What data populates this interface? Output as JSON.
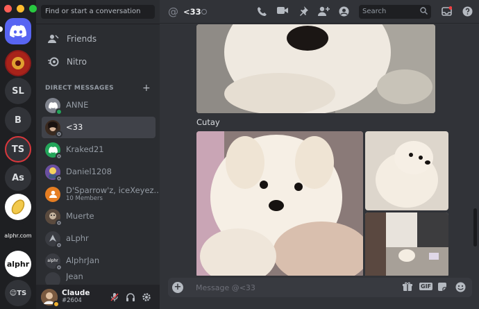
{
  "window": {
    "controls": [
      "close",
      "minimize",
      "maximize"
    ]
  },
  "rail": {
    "servers": [
      {
        "label": "",
        "icon": "discord-logo-icon",
        "kind": "home"
      },
      {
        "label": "",
        "icon": "server-avatar-icon"
      },
      {
        "label": "SL"
      },
      {
        "label": "B"
      },
      {
        "label": "TS"
      },
      {
        "label": "As"
      },
      {
        "label": "",
        "icon": "server-avatar-icon"
      },
      {
        "label": "alphr.com"
      },
      {
        "label": "alphr"
      },
      {
        "label": "😉TS"
      }
    ]
  },
  "sidebar": {
    "search_placeholder": "Find or start a conversation",
    "nav": [
      {
        "label": "Friends",
        "icon": "friends-icon"
      },
      {
        "label": "Nitro",
        "icon": "nitro-icon"
      }
    ],
    "dm_header": "DIRECT MESSAGES",
    "dm_add": "+",
    "dms": [
      {
        "name": "ANNE",
        "status": "online",
        "avatar_color": "#80848e"
      },
      {
        "name": "<33",
        "status": "offline",
        "avatar_color": "#4e3b2e",
        "active": true
      },
      {
        "name": "Kraked21",
        "status": "offline",
        "avatar_color": "#23a55a"
      },
      {
        "name": "Daniel1208",
        "status": "offline",
        "avatar_color": "#7b5ea7"
      },
      {
        "name": "D'Sparrow'z, iceXeyez...",
        "sub": "10 Members",
        "avatar_color": "#e67e22"
      },
      {
        "name": "Muerte",
        "status": "offline",
        "avatar_color": "#6b5b4e"
      },
      {
        "name": "aLphr",
        "status": "offline",
        "avatar_color": "#3a3c42"
      },
      {
        "name": "AlphrJan",
        "status": "offline",
        "avatar_color": "#3a3c42"
      },
      {
        "name": "Jean",
        "status": "offline",
        "avatar_color": "#3a3c42"
      }
    ]
  },
  "user": {
    "name": "Claude",
    "tag": "#2604"
  },
  "header": {
    "channel": "<33",
    "search_placeholder": "Search",
    "icons": [
      "call-icon",
      "video-icon",
      "pin-icon",
      "add-friend-icon",
      "profile-icon",
      "inbox-icon",
      "help-icon"
    ]
  },
  "messages": [
    {
      "type": "image",
      "alt": "dog photo top"
    },
    {
      "type": "text",
      "text": "Cutay"
    },
    {
      "type": "image-grid",
      "count": 3
    }
  ],
  "composer": {
    "placeholder": "Message @<33",
    "gif_label": "GIF"
  },
  "colors": {
    "accent": "#5865f2",
    "online": "#23a55a",
    "dnd_ring": "#da373c"
  }
}
